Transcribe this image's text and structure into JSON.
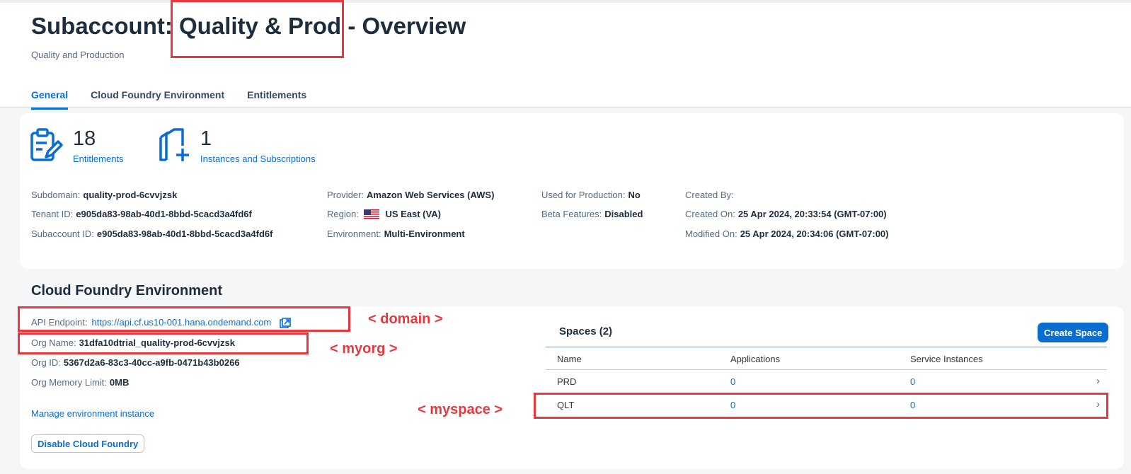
{
  "header": {
    "title_prefix": "Subaccount: ",
    "title_name": "Quality & Prod",
    "title_suffix": " - Overview",
    "subtitle": "Quality and Production",
    "tabs": [
      "General",
      "Cloud Foundry Environment",
      "Entitlements"
    ]
  },
  "stats": {
    "entitlements": {
      "count": "18",
      "label": "Entitlements"
    },
    "instances": {
      "count": "1",
      "label": "Instances and Subscriptions"
    }
  },
  "details": {
    "subdomain": {
      "label": "Subdomain:",
      "value": "quality-prod-6cvvjzsk"
    },
    "tenant_id": {
      "label": "Tenant ID:",
      "value": "e905da83-98ab-40d1-8bbd-5cacd3a4fd6f"
    },
    "subaccount_id": {
      "label": "Subaccount ID:",
      "value": "e905da83-98ab-40d1-8bbd-5cacd3a4fd6f"
    },
    "provider": {
      "label": "Provider:",
      "value": "Amazon Web Services (AWS)"
    },
    "region": {
      "label": "Region:",
      "value": "US East (VA)"
    },
    "environment": {
      "label": "Environment:",
      "value": "Multi-Environment"
    },
    "used_for_production": {
      "label": "Used for Production:",
      "value": "No"
    },
    "beta_features": {
      "label": "Beta Features:",
      "value": "Disabled"
    },
    "created_by": {
      "label": "Created By:",
      "value": ""
    },
    "created_on": {
      "label": "Created On:",
      "value": "25 Apr 2024, 20:33:54 (GMT-07:00)"
    },
    "modified_on": {
      "label": "Modified On:",
      "value": "25 Apr 2024, 20:34:06 (GMT-07:00)"
    }
  },
  "cf": {
    "section_title": "Cloud Foundry Environment",
    "api_endpoint": {
      "label": "API Endpoint:",
      "value": "https://api.cf.us10-001.hana.ondemand.com"
    },
    "org_name": {
      "label": "Org Name:",
      "value": "31dfa10dtrial_quality-prod-6cvvjzsk"
    },
    "org_id": {
      "label": "Org ID:",
      "value": "5367d2a6-83c3-40cc-a9fb-0471b43b0266"
    },
    "org_memory": {
      "label": "Org Memory Limit:",
      "value": "0MB"
    },
    "manage_link": "Manage environment instance",
    "disable_button": "Disable Cloud Foundry"
  },
  "spaces": {
    "title": "Spaces (2)",
    "create_button": "Create Space",
    "columns": [
      "Name",
      "Applications",
      "Service Instances"
    ],
    "rows": [
      {
        "name": "PRD",
        "applications": "0",
        "service_instances": "0"
      },
      {
        "name": "QLT",
        "applications": "0",
        "service_instances": "0"
      }
    ],
    "chevron": "›"
  },
  "annotations": {
    "domain": "< domain >",
    "myorg": "< myorg >",
    "myspace": "< myspace >"
  },
  "colors": {
    "accent": "#0a6ed1",
    "annotation": "#e8383d"
  },
  "icons": {
    "entitlements": "clipboard-edit-icon",
    "instances": "instances-add-icon",
    "external_link": "external-link-icon",
    "flag": "us-flag-icon",
    "chevron": "chevron-right-icon"
  }
}
